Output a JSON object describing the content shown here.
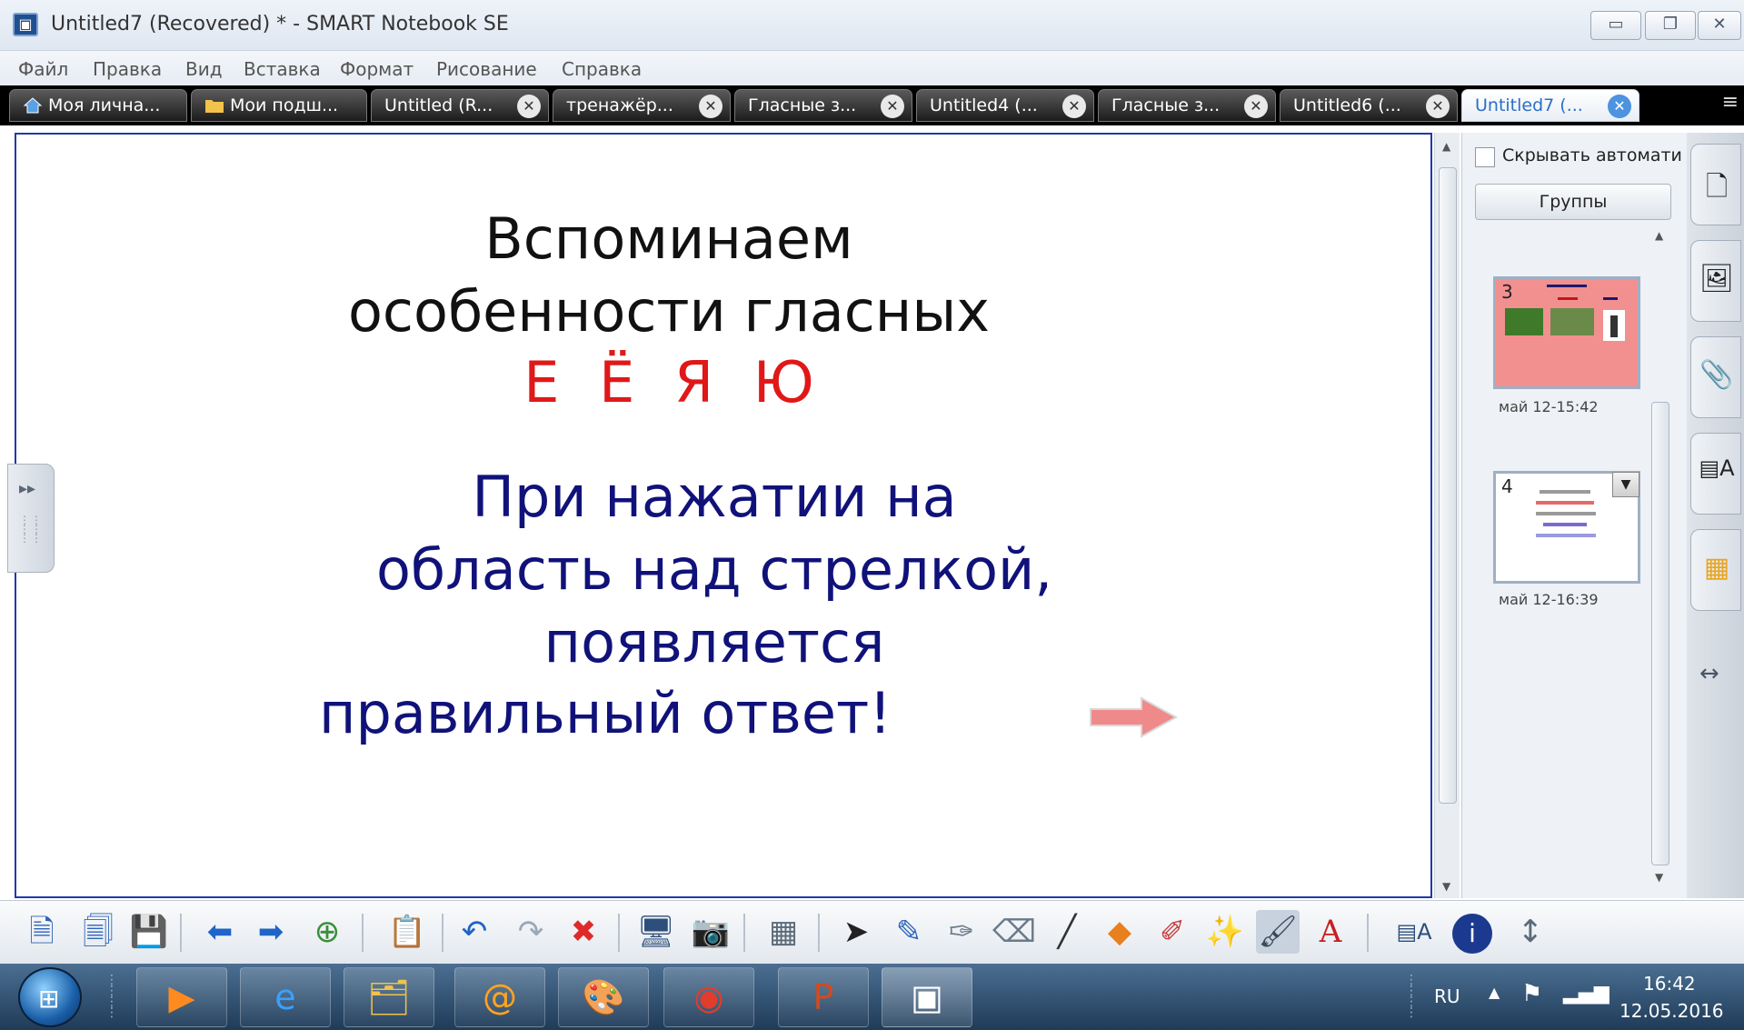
{
  "window": {
    "title": "Untitled7 (Recovered) * - SMART Notebook SE",
    "app_icon": "smart-notebook-icon",
    "controls": [
      "minimize-icon",
      "restore-icon",
      "close-icon"
    ]
  },
  "menu": [
    "Файл",
    "Правка",
    "Вид",
    "Вставка",
    "Формат",
    "Рисование",
    "Справка"
  ],
  "tabs": [
    {
      "label": "Моя лична...",
      "icon": "home-icon",
      "closable": false
    },
    {
      "label": "Мои подш...",
      "icon": "folder-icon",
      "closable": false
    },
    {
      "label": "Untitled (R...",
      "closable": true
    },
    {
      "label": "тренажёр...",
      "closable": true
    },
    {
      "label": "Гласные з...",
      "closable": true
    },
    {
      "label": "Untitled4 (...",
      "closable": true
    },
    {
      "label": "Гласные з...",
      "closable": true
    },
    {
      "label": "Untitled6 (...",
      "closable": true
    },
    {
      "label": "Untitled7 (...",
      "closable": true,
      "active": true
    }
  ],
  "slide": {
    "heading_line1": "Вспоминаем",
    "heading_line2": "особенности гласных",
    "letters": "Е Ё Я Ю",
    "body_line1": "При нажатии на",
    "body_line2": "область над стрелкой,",
    "body_line3": "появляется",
    "body_line4": "правильный ответ!",
    "colors": {
      "heading": "#111111",
      "letters": "#e01818",
      "body": "#10127a",
      "arrow": "#f08a8a"
    }
  },
  "sorter": {
    "auto_hide_label": "Скрывать автомати",
    "auto_hide_checked": false,
    "groups_button": "Группы",
    "pages": [
      {
        "number": "3",
        "date": "май 12-15:42"
      },
      {
        "number": "4",
        "date": "май 12-16:39"
      }
    ]
  },
  "side_tabs": [
    "page-sorter-icon",
    "gallery-icon",
    "attachments-icon",
    "properties-icon",
    "addons-icon",
    "swap-side-icon"
  ],
  "toolbar": [
    "new-page-icon",
    "delete-page-icon",
    "save-icon",
    "previous-page-icon",
    "next-page-icon",
    "add-page-icon",
    "paste-icon",
    "undo-icon",
    "redo-icon",
    "delete-icon",
    "screen-shade-icon",
    "screen-capture-icon",
    "table-icon",
    "select-icon",
    "pen-icon",
    "creative-pen-icon",
    "eraser-icon",
    "line-icon",
    "shapes-icon",
    "shape-pen-icon",
    "magic-pen-icon",
    "fill-icon",
    "text-icon",
    "properties-icon",
    "info-icon",
    "move-toolbar-icon"
  ],
  "taskbar": {
    "apps": [
      "media-player-icon",
      "internet-explorer-icon",
      "file-explorer-icon",
      "mail-agent-icon",
      "paint-icon",
      "chrome-icon",
      "powerpoint-icon",
      "smart-notebook-icon"
    ],
    "language": "RU",
    "time": "16:42",
    "date": "12.05.2016"
  }
}
